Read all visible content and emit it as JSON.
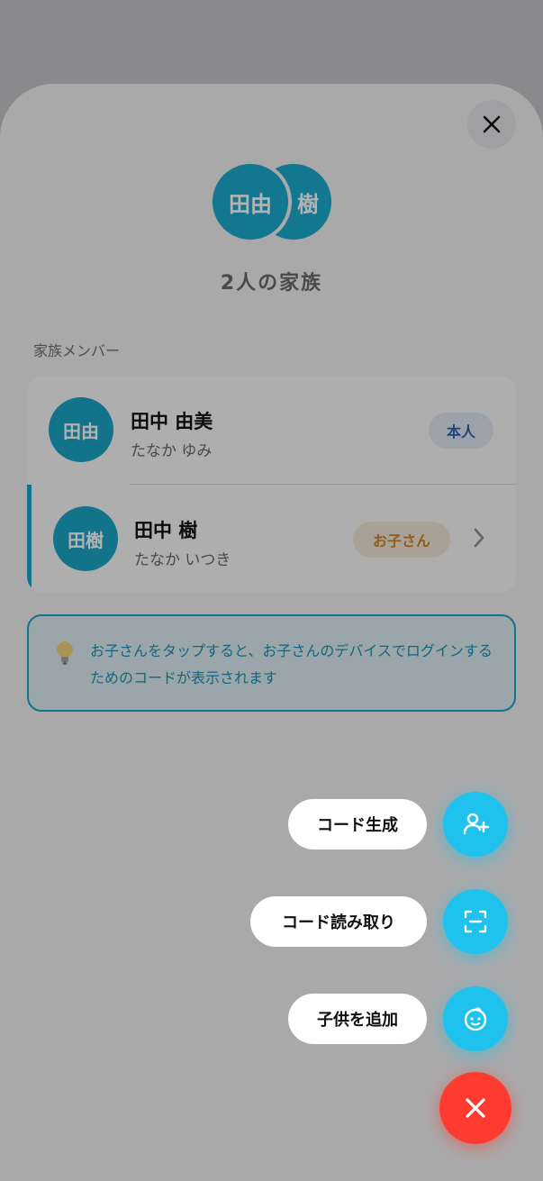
{
  "family": {
    "avatar_front": "田由",
    "avatar_back": "樹",
    "title": "2人の家族"
  },
  "members_section": {
    "label": "家族メンバー",
    "members": [
      {
        "avatar": "田由",
        "name": "田中 由美",
        "kana": "たなか ゆみ",
        "badge": "本人"
      },
      {
        "avatar": "田樹",
        "name": "田中 樹",
        "kana": "たなか いつき",
        "badge": "お子さん"
      }
    ]
  },
  "hint": {
    "icon": "lightbulb-icon",
    "text": "お子さんをタップすると、お子さんのデバイスでログインするためのコードが表示されます"
  },
  "fab_menu": {
    "items": [
      {
        "label": "コード生成",
        "icon": "add-person-icon"
      },
      {
        "label": "コード読み取り",
        "icon": "scan-icon"
      },
      {
        "label": "子供を追加",
        "icon": "baby-face-icon"
      }
    ],
    "main_icon": "close-icon"
  },
  "colors": {
    "accent": "#1aa5c8",
    "fab": "#1ec2ec",
    "close_fab": "#ff3b30",
    "badge_self_text": "#2a62b8",
    "badge_child_text": "#c9852a"
  }
}
